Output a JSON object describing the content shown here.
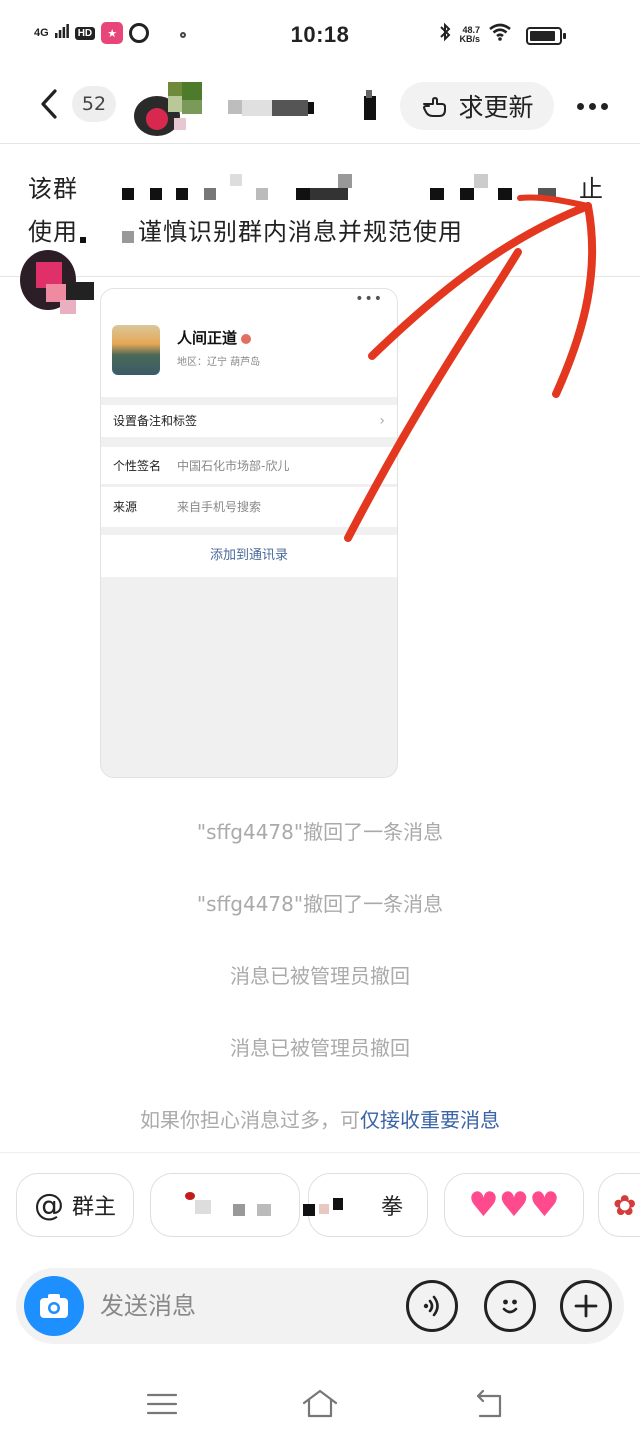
{
  "status_bar": {
    "network": "4G",
    "hd": "HD",
    "time": "10:18",
    "speed_value": "48.7",
    "speed_unit": "KB/s",
    "battery_level": 0.9
  },
  "header": {
    "unread_count": "52",
    "request_update_label": "求更新"
  },
  "notice": {
    "line1_start": "该群",
    "line1_end": "止",
    "line2_start": "使用",
    "line2_visible": "谨慎识别群内消息并规范使用"
  },
  "shared_card": {
    "name": "人间正道",
    "region": "地区：辽宁  葫芦岛",
    "set_remark_label": "设置备注和标签",
    "signature_key": "个性签名",
    "signature_value": "中国石化市场部-欣儿",
    "source_key": "来源",
    "source_value": "来自手机号搜索",
    "add_contact_label": "添加到通讯录"
  },
  "system_messages": [
    "\"sffg4478\"撤回了一条消息",
    "\"sffg4478\"撤回了一条消息",
    "消息已被管理员撤回",
    "消息已被管理员撤回"
  ],
  "hint": {
    "prefix": "如果你担心消息过多，可",
    "link": "仅接收重要消息"
  },
  "quick_replies": {
    "mention_owner": "群主",
    "chip_3_suffix": "拳"
  },
  "input": {
    "placeholder": "发送消息"
  },
  "icons": {
    "back": "back-icon",
    "request": "hand-point-icon",
    "more": "more-icon",
    "camera": "camera-icon",
    "voice": "voice-icon",
    "emoji": "emoji-icon",
    "plus": "plus-icon"
  },
  "colors": {
    "accent_blue": "#1e8fff",
    "link_blue": "#3a64a8",
    "annotation_red": "#e3381f",
    "heart_pink": "#ff4a8d"
  }
}
